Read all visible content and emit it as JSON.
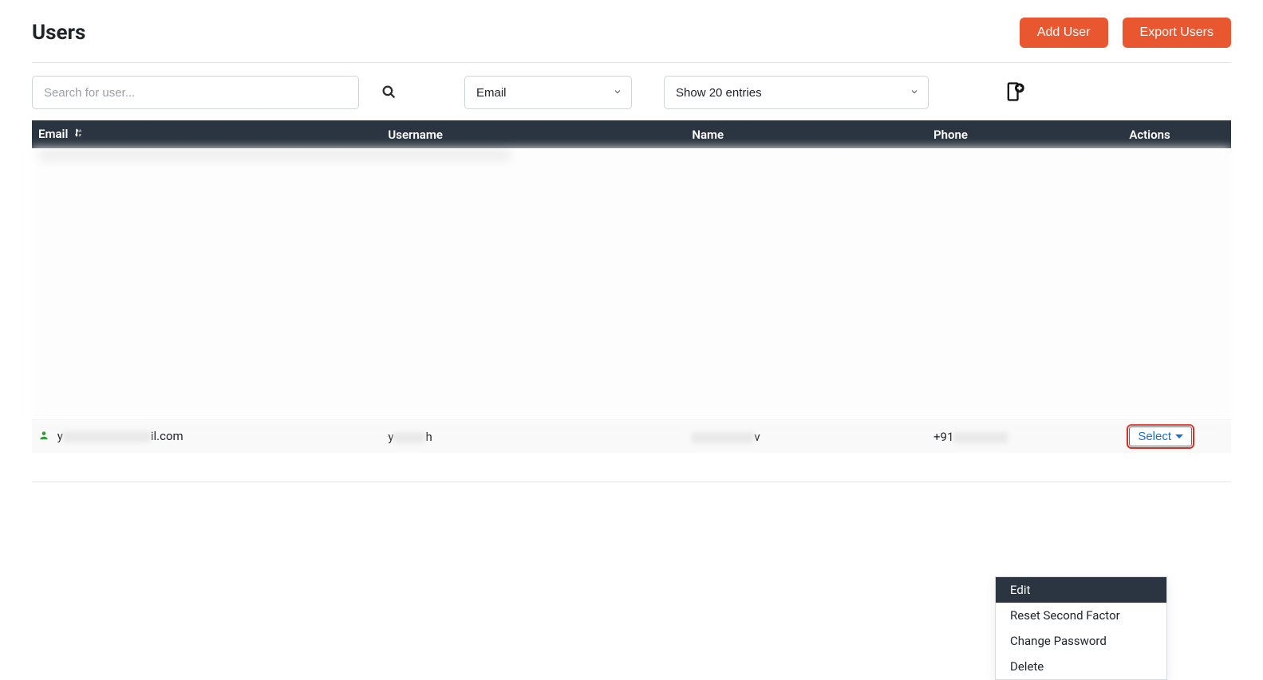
{
  "header": {
    "title": "Users",
    "add_user_label": "Add User",
    "export_users_label": "Export Users"
  },
  "filters": {
    "search_placeholder": "Search for user...",
    "filter_by": "Email",
    "entries": "Show 20 entries"
  },
  "table": {
    "columns": {
      "email": "Email",
      "username": "Username",
      "name": "Name",
      "phone": "Phone",
      "actions": "Actions"
    }
  },
  "visible_row": {
    "email_prefix": "y",
    "email_suffix": "il.com",
    "username_prefix": "y",
    "username_suffix": "h",
    "name_prefix": "",
    "name_suffix": "v",
    "phone_prefix": "+91",
    "action_label": "Select"
  },
  "action_menu": {
    "edit": "Edit",
    "reset_second_factor": "Reset Second Factor",
    "change_password": "Change Password",
    "delete": "Delete"
  }
}
